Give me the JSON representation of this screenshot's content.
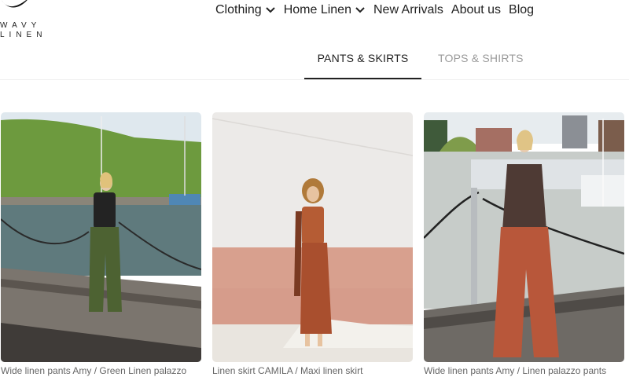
{
  "brand": {
    "line1": "WAVY",
    "line2": "LINEN"
  },
  "nav": [
    {
      "label": "Clothing",
      "dropdown": true
    },
    {
      "label": "Home Linen",
      "dropdown": true
    },
    {
      "label": "New Arrivals",
      "dropdown": false
    },
    {
      "label": "About us",
      "dropdown": false
    },
    {
      "label": "Blog",
      "dropdown": false
    }
  ],
  "tabs": [
    {
      "label": "PANTS & SKIRTS",
      "active": true
    },
    {
      "label": "TOPS & SHIRTS",
      "active": false
    }
  ],
  "products": [
    {
      "title": "Wide linen pants Amy / Green Linen palazzo",
      "image": "woman-in-green-linen-pants-by-harbor"
    },
    {
      "title": "Linen skirt CAMILA / Maxi linen skirt",
      "image": "woman-in-rust-linen-skirt-by-pink-wall"
    },
    {
      "title": "Wide linen pants Amy / Linen palazzo pants",
      "image": "woman-in-rust-linen-pants-by-harbor"
    }
  ],
  "colors": {
    "text": "#222222",
    "muted": "#9a9a9a",
    "caption": "#666666"
  }
}
